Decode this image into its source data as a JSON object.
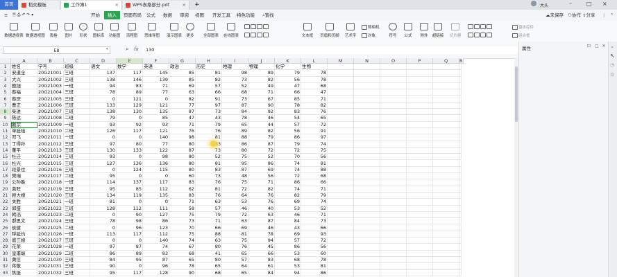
{
  "tabs": {
    "home": "首页",
    "doc1": "稻壳模板",
    "doc2": "工作簿1",
    "doc3": "WPS表格部分.pdf",
    "add": "+"
  },
  "user": "大头",
  "menus": [
    "开始",
    "插入",
    "页面布局",
    "公式",
    "数据",
    "审阅",
    "视图",
    "开发工具",
    "特色功能"
  ],
  "menu_active": "插入",
  "search_label": "查找",
  "top_right": [
    "未保存",
    "协作",
    "分享"
  ],
  "toolbar": {
    "items": [
      "数据透视表",
      "数据透视图",
      "表格",
      "图片",
      "形状",
      "图标库",
      "功能图",
      "流程图",
      "思维导图",
      "演示图表",
      "更多",
      "全部图表",
      "在线图表",
      "文本框",
      "页眉和页脚",
      "艺术字",
      "符号",
      "公式",
      "附件",
      "超链接",
      "切片器"
    ],
    "small": [
      "照相机",
      "对象"
    ],
    "right_small": [
      "窗体控件",
      "组合框"
    ]
  },
  "formula_bar": {
    "name_box": "E8",
    "fx": "fx",
    "value": "130"
  },
  "right_pane": {
    "title": "属性"
  },
  "columns": [
    "A",
    "B",
    "C",
    "D",
    "E",
    "F",
    "G",
    "H",
    "I",
    "J",
    "K",
    "L",
    "M",
    "N",
    "O",
    "P",
    "Q",
    "R"
  ],
  "header_row": [
    "姓名",
    "学号",
    "班级",
    "语文",
    "数学",
    "英语",
    "政治",
    "历史",
    "地理",
    "物理",
    "化学",
    "生物"
  ],
  "rows": [
    [
      "安道全",
      "20G21001",
      "三班",
      "137",
      "117",
      "145",
      "85",
      "81",
      "98",
      "89",
      "79",
      "78"
    ],
    [
      "大兴",
      "20G21002",
      "三班",
      "138",
      "146",
      "139",
      "85",
      "82",
      "73",
      "82",
      "56",
      "78"
    ],
    [
      "鲍旭",
      "20G21003",
      "一班",
      "94",
      "83",
      "71",
      "69",
      "57",
      "52",
      "49",
      "47",
      "68"
    ],
    [
      "蔡福",
      "20G21004",
      "三班",
      "78",
      "89",
      "77",
      "63",
      "66",
      "68",
      "71",
      "66",
      "47"
    ],
    [
      "蔡庆",
      "20G21005",
      "三班",
      "0",
      "121",
      "0",
      "82",
      "91",
      "73",
      "67",
      "85",
      "71"
    ],
    [
      "曹正",
      "20G21006",
      "三班",
      "133",
      "129",
      "121",
      "77",
      "97",
      "87",
      "90",
      "78",
      "82"
    ],
    [
      "柴进",
      "20G21007",
      "三班",
      "138",
      "130",
      "135",
      "87",
      "73",
      "84",
      "92",
      "83",
      "76"
    ],
    [
      "陈达",
      "20G21008",
      "二班",
      "79",
      "0",
      "85",
      "47",
      "43",
      "78",
      "46",
      "54",
      "65"
    ],
    [
      "戴宗",
      "20G21009",
      "一班",
      "93",
      "92",
      "93",
      "71",
      "79",
      "65",
      "44",
      "57",
      "72"
    ],
    [
      "单廷珪",
      "20G21010",
      "二班",
      "126",
      "117",
      "121",
      "76",
      "76",
      "89",
      "82",
      "56",
      "91"
    ],
    [
      "邓飞",
      "20G21011",
      "一班",
      "0",
      "0",
      "140",
      "98",
      "81",
      "88",
      "79",
      "86",
      "97"
    ],
    [
      "丁得孙",
      "20G21012",
      "三班",
      "97",
      "80",
      "77",
      "80",
      "63",
      "86",
      "87",
      "79",
      "74"
    ],
    [
      "董平",
      "20G21013",
      "三班",
      "130",
      "133",
      "122",
      "87",
      "73",
      "80",
      "72",
      "72",
      "75"
    ],
    [
      "杜迁",
      "20G21014",
      "三班",
      "93",
      "0",
      "98",
      "80",
      "52",
      "75",
      "52",
      "70",
      "56"
    ],
    [
      "杜兴",
      "20G21015",
      "三班",
      "127",
      "136",
      "136",
      "80",
      "81",
      "95",
      "86",
      "74",
      "81"
    ],
    [
      "段景住",
      "20G21016",
      "三班",
      "0",
      "124",
      "115",
      "80",
      "83",
      "87",
      "69",
      "74",
      "88"
    ],
    [
      "樊瑞",
      "20G21017",
      "二班",
      "95",
      "0",
      "0",
      "60",
      "73",
      "48",
      "56",
      "72",
      "68"
    ],
    [
      "公孙胜",
      "20G21018",
      "一班",
      "114",
      "137",
      "117",
      "83",
      "76",
      "75",
      "71",
      "86",
      "66"
    ],
    [
      "龚旺",
      "20G21019",
      "三班",
      "95",
      "85",
      "112",
      "62",
      "81",
      "72",
      "82",
      "74",
      "71"
    ],
    [
      "顾大嫂",
      "20G21020",
      "三班",
      "134",
      "119",
      "135",
      "83",
      "76",
      "64",
      "76",
      "82",
      "79"
    ],
    [
      "关胜",
      "20G21021",
      "一班",
      "81",
      "0",
      "0",
      "71",
      "63",
      "53",
      "76",
      "69",
      "74"
    ],
    [
      "郭盛",
      "20G21022",
      "三班",
      "128",
      "112",
      "111",
      "58",
      "57",
      "46",
      "40",
      "53",
      "52"
    ],
    [
      "韩滔",
      "20G21023",
      "二班",
      "0",
      "90",
      "127",
      "75",
      "79",
      "72",
      "63",
      "46",
      "71"
    ],
    [
      "郝思文",
      "20G21024",
      "三班",
      "78",
      "98",
      "86",
      "73",
      "71",
      "63",
      "87",
      "84",
      "73"
    ],
    [
      "侯健",
      "20G21025",
      "二班",
      "0",
      "96",
      "123",
      "70",
      "66",
      "69",
      "46",
      "43",
      "66"
    ],
    [
      "呼延灼",
      "20G21026",
      "一班",
      "113",
      "117",
      "112",
      "75",
      "88",
      "81",
      "78",
      "69",
      "93"
    ],
    [
      "扈三娘",
      "20G21027",
      "三班",
      "0",
      "0",
      "140",
      "74",
      "63",
      "75",
      "94",
      "57",
      "72"
    ],
    [
      "花荣",
      "20G21028",
      "一班",
      "97",
      "87",
      "74",
      "67",
      "80",
      "76",
      "45",
      "86",
      "56"
    ],
    [
      "皇甫端",
      "20G21029",
      "二班",
      "86",
      "89",
      "83",
      "68",
      "41",
      "65",
      "66",
      "53",
      "60"
    ],
    [
      "黄信",
      "20G21030",
      "三班",
      "84",
      "95",
      "87",
      "65",
      "80",
      "57",
      "83",
      "68",
      "78"
    ],
    [
      "蒋敬",
      "20G21031",
      "三班",
      "90",
      "0",
      "96",
      "78",
      "65",
      "64",
      "61",
      "53",
      "81"
    ],
    [
      "焦挺",
      "20G21032",
      "三班",
      "95",
      "117",
      "128",
      "90",
      "68",
      "65",
      "84",
      "94",
      "86"
    ]
  ]
}
